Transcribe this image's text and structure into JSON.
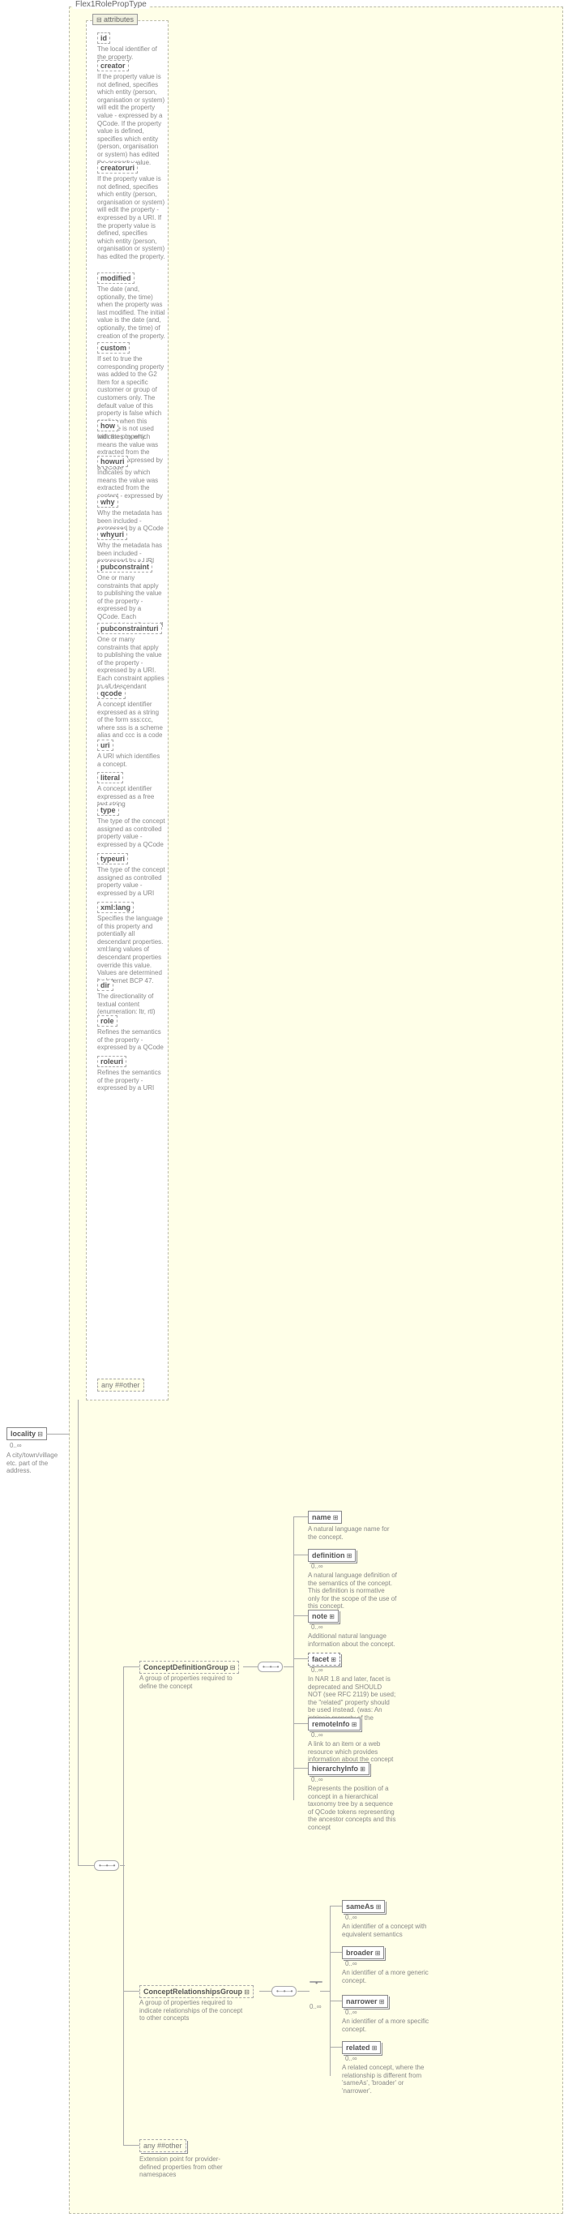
{
  "type_name": "Flex1RolePropType",
  "attributes_label": "attributes",
  "root": {
    "name": "locality",
    "occurrence": "0..∞",
    "desc": "A city/town/village etc. part of the address."
  },
  "attributes": [
    {
      "name": "id",
      "desc": "The local identifier of the property."
    },
    {
      "name": "creator",
      "desc": "If the property value is not defined, specifies which entity (person, organisation or system) will edit the property value - expressed by a QCode. If the property value is defined, specifies which entity (person, organisation or system) has edited the property value."
    },
    {
      "name": "creatoruri",
      "desc": "If the property value is not defined, specifies which entity (person, organisation or system) will edit the property - expressed by a URI. If the property value is defined, specifies which entity (person, organisation or system) has edited the property."
    },
    {
      "name": "modified",
      "desc": "The date (and, optionally, the time) when the property was last modified. The initial value is the date (and, optionally, the time) of creation of the property."
    },
    {
      "name": "custom",
      "desc": "If set to true the corresponding property was added to the G2 Item for a specific customer or group of customers only. The default value of this property is false which applies when this attribute is not used with the property."
    },
    {
      "name": "how",
      "desc": "Indicates by which means the value was extracted from the content - expressed by a QCode"
    },
    {
      "name": "howuri",
      "desc": "Indicates by which means the value was extracted from the content - expressed by a URI"
    },
    {
      "name": "why",
      "desc": "Why the metadata has been included - expressed by a QCode"
    },
    {
      "name": "whyuri",
      "desc": "Why the metadata has been included - expressed by a URI"
    },
    {
      "name": "pubconstraint",
      "desc": "One or many constraints that apply to publishing the value of the property - expressed by a QCode. Each constraint applies to all descendant elements."
    },
    {
      "name": "pubconstrainturi",
      "desc": "One or many constraints that apply to publishing the value of the property - expressed by a URI. Each constraint applies to all descendant elements."
    },
    {
      "name": "qcode",
      "desc": "A concept identifier expressed as a string of the form sss:ccc, where sss is a scheme alias and ccc is a code"
    },
    {
      "name": "uri",
      "desc": "A URI which identifies a concept."
    },
    {
      "name": "literal",
      "desc": "A concept identifier expressed as a free text string"
    },
    {
      "name": "type",
      "desc": "The type of the concept assigned as controlled property value - expressed by a QCode"
    },
    {
      "name": "typeuri",
      "desc": "The type of the concept assigned as controlled property value - expressed by a URI"
    },
    {
      "name": "xml:lang",
      "desc": "Specifies the language of this property and potentially all descendant properties. xml:lang values of descendant properties override this value. Values are determined by Internet BCP 47."
    },
    {
      "name": "dir",
      "desc": "The directionality of textual content (enumeration: ltr, rtl)"
    },
    {
      "name": "role",
      "desc": "Refines the semantics of the property - expressed by a QCode"
    },
    {
      "name": "roleuri",
      "desc": "Refines the semantics of the property - expressed by a URI"
    }
  ],
  "any_attr": "any ##other",
  "groups": [
    {
      "name": "ConceptDefinitionGroup",
      "desc": "A group of properties required to define the concept"
    },
    {
      "name": "ConceptRelationshipsGroup",
      "desc": "A group of properties required to indicate relationships of the concept to other concepts"
    }
  ],
  "def_children": [
    {
      "name": "name",
      "occ": "",
      "desc": "A natural language name for the concept."
    },
    {
      "name": "definition",
      "occ": "0..∞",
      "desc": "A natural language definition of the semantics of the concept. This definition is normative only for the scope of the use of this concept."
    },
    {
      "name": "note",
      "occ": "0..∞",
      "desc": "Additional natural language information about the concept."
    },
    {
      "name": "facet",
      "occ": "0..∞",
      "desc": "In NAR 1.8 and later, facet is deprecated and SHOULD NOT (see RFC 2119) be used; the \"related\" property should be used instead. (was: An intrinsic property of the concept.)"
    },
    {
      "name": "remoteInfo",
      "occ": "0..∞",
      "desc": "A link to an item or a web resource which provides information about the concept"
    },
    {
      "name": "hierarchyInfo",
      "occ": "0..∞",
      "desc": "Represents the position of a concept in a hierarchical taxonomy tree by a sequence of QCode tokens representing the ancestor concepts and this concept"
    }
  ],
  "rel_children": [
    {
      "name": "sameAs",
      "occ": "0..∞",
      "desc": "An identifier of a concept with equivalent semantics"
    },
    {
      "name": "broader",
      "occ": "0..∞",
      "desc": "An identifier of a more generic concept."
    },
    {
      "name": "narrower",
      "occ": "0..∞",
      "desc": "An identifier of a more specific concept."
    },
    {
      "name": "related",
      "occ": "0..∞",
      "desc": "A related concept, where the relationship is different from 'sameAs', 'broader' or 'narrower'."
    }
  ],
  "any_elem": {
    "label": "any ##other",
    "desc": "Extension point for provider-defined properties from other namespaces"
  }
}
